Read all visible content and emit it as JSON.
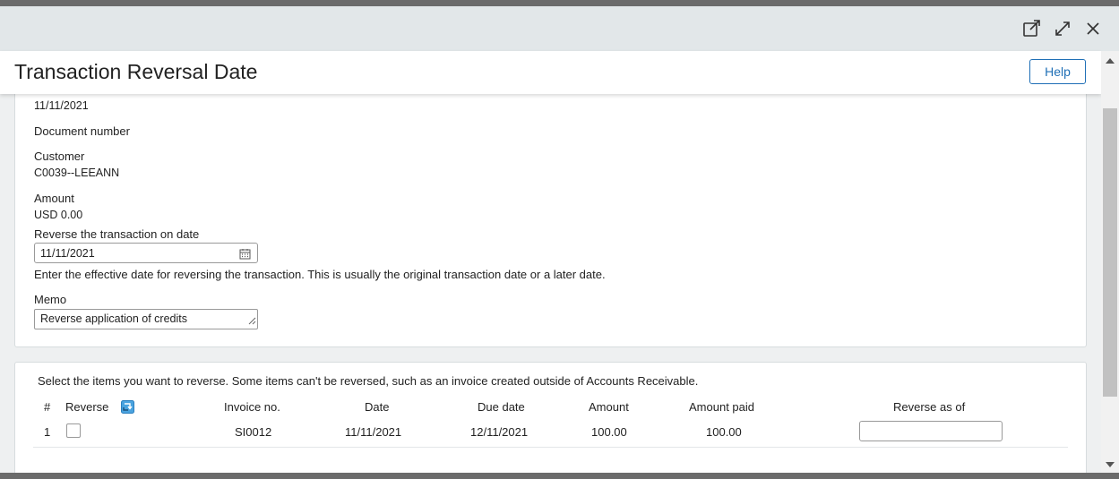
{
  "dialog": {
    "title": "Transaction Reversal Date",
    "help_label": "Help"
  },
  "form": {
    "top_date": "11/11/2021",
    "document_number_label": "Document number",
    "customer_label": "Customer",
    "customer_value": "C0039--LEEANN",
    "amount_label": "Amount",
    "amount_value": "USD 0.00",
    "reverse_date_label": "Reverse the transaction on date",
    "reverse_date_value": "11/11/2021",
    "reverse_date_hint": "Enter the effective date for reversing the transaction. This is usually the original transaction date or a later date.",
    "memo_label": "Memo",
    "memo_value": "Reverse application of credits"
  },
  "items": {
    "instructions": "Select the items you want to reverse. Some items can't be reversed, such as an invoice created outside of Accounts Receivable.",
    "headers": {
      "num": "#",
      "reverse": "Reverse",
      "invoice": "Invoice no.",
      "date": "Date",
      "due": "Due date",
      "amount": "Amount",
      "paid": "Amount paid",
      "reverse_as_of": "Reverse as of"
    },
    "rows": [
      {
        "num": "1",
        "invoice": "SI0012",
        "date": "11/11/2021",
        "due": "12/11/2021",
        "amount": "100.00",
        "paid": "100.00",
        "reverse_as_of": ""
      }
    ]
  },
  "icons": {
    "open_new": "open-in-new-window-icon",
    "expand": "expand-icon",
    "close": "close-icon",
    "calendar": "calendar-icon",
    "reverse_all": "reverse-all-icon"
  }
}
